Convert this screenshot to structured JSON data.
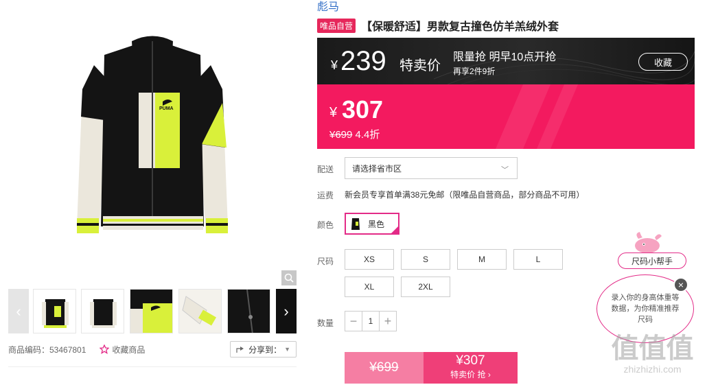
{
  "brand": "彪马",
  "title": {
    "badge": "唯品自营",
    "text": "【保暖舒适】男款复古撞色仿羊羔绒外套"
  },
  "promo": {
    "currency": "¥",
    "price": "239",
    "label": "特卖价",
    "info_line1": "限量抢 明早10点开抢",
    "info_line2": "再享2件9折",
    "collect_label": "收藏"
  },
  "price": {
    "currency": "¥",
    "current": "307",
    "original": "¥699",
    "discount": "4.4折"
  },
  "delivery": {
    "label": "配送",
    "select_text": "请选择省市区"
  },
  "shipping": {
    "label": "运费",
    "text": "新会员专享首单满38元免邮（限唯品自营商品，部分商品不可用）"
  },
  "color": {
    "label": "颜色",
    "selected": "黑色"
  },
  "size": {
    "label": "尺码",
    "options": [
      "XS",
      "S",
      "M",
      "L",
      "XL",
      "2XL"
    ]
  },
  "quantity": {
    "label": "数量",
    "value": "1",
    "minus": "−",
    "plus": "+"
  },
  "buy": {
    "original": "¥699",
    "price": "¥307",
    "action": "特卖价 抢 ›"
  },
  "product_meta": {
    "code": "商品编码：53467801",
    "favorite": "收藏商品",
    "share": "分享到："
  },
  "helper": {
    "button": "尺码小帮手",
    "bubble": "录入你的身高体重等数据，为你精准推荐尺码",
    "close": "×"
  },
  "watermark": {
    "big": "值值值",
    "small": "zhizhizhi.com"
  },
  "colors": {
    "accent": "#f31a5f",
    "brand_link": "#2f6cc6",
    "promo_bg": "#1a1a1a",
    "jacket_lime": "#d9f03a",
    "jacket_black": "#141414"
  }
}
